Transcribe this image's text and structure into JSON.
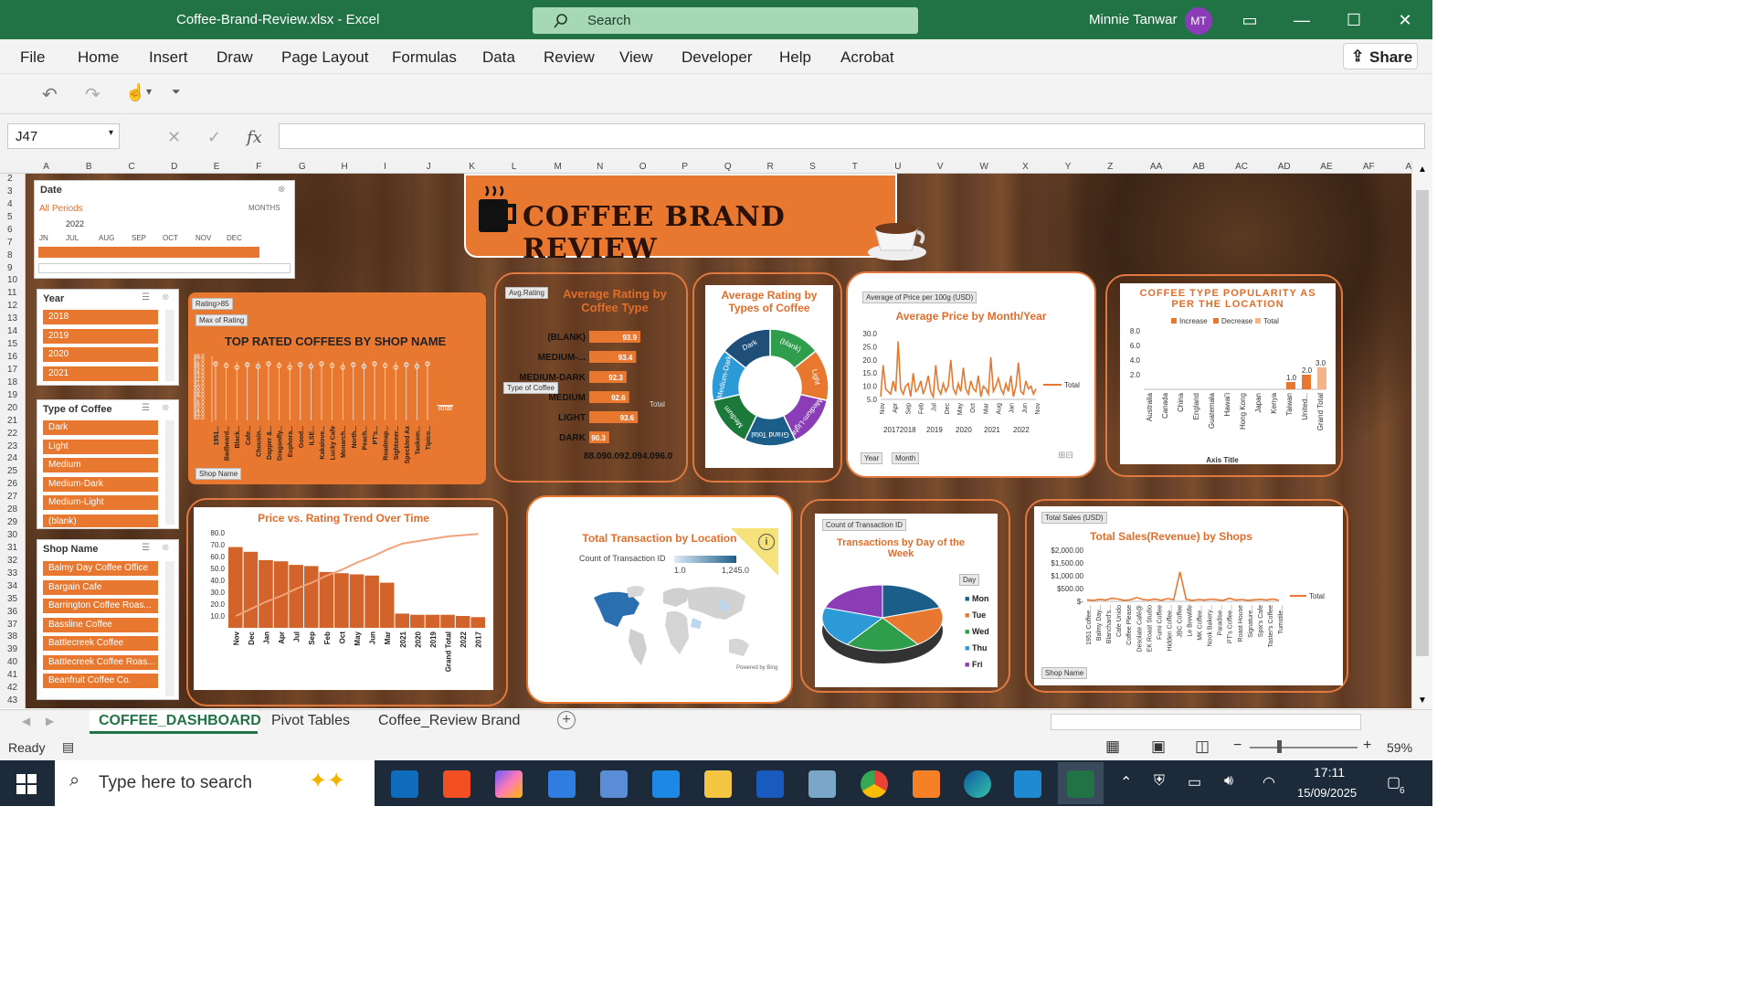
{
  "window": {
    "file_name": "Coffee-Brand-Review.xlsx  -  Excel",
    "search_placeholder": "Search",
    "user_name": "Minnie Tanwar",
    "user_initials": "MT"
  },
  "menu": [
    "File",
    "Home",
    "Insert",
    "Draw",
    "Page Layout",
    "Formulas",
    "Data",
    "Review",
    "View",
    "Developer",
    "Help",
    "Acrobat"
  ],
  "share_label": "Share",
  "formula": {
    "name_box": "J47",
    "fx": "fx",
    "value": ""
  },
  "columns": [
    "A",
    "B",
    "C",
    "D",
    "E",
    "F",
    "G",
    "H",
    "I",
    "J",
    "K",
    "L",
    "M",
    "N",
    "O",
    "P",
    "Q",
    "R",
    "S",
    "T",
    "U",
    "V",
    "W",
    "X",
    "Y",
    "Z",
    "AA",
    "AB",
    "AC",
    "AD",
    "AE",
    "AF",
    "AG"
  ],
  "rows": [
    "2",
    "3",
    "4",
    "5",
    "6",
    "7",
    "8",
    "9",
    "10",
    "11",
    "12",
    "13",
    "14",
    "15",
    "16",
    "17",
    "18",
    "19",
    "20",
    "21",
    "22",
    "23",
    "24",
    "25",
    "26",
    "27",
    "28",
    "29",
    "30",
    "31",
    "32",
    "33",
    "34",
    "35",
    "36",
    "37",
    "38",
    "39",
    "40",
    "41",
    "42",
    "43"
  ],
  "dashboard": {
    "title": "COFFEE BRAND REVIEW",
    "date_slicer": {
      "title": "Date",
      "periods": "All Periods",
      "level": "MONTHS",
      "year": "2022",
      "months": [
        "JN",
        "JUL",
        "AUG",
        "SEP",
        "OCT",
        "NOV",
        "DEC"
      ]
    },
    "year_slicer": {
      "title": "Year",
      "items": [
        "2018",
        "2019",
        "2020",
        "2021"
      ]
    },
    "type_slicer": {
      "title": "Type of Coffee",
      "items": [
        "Dark",
        "Light",
        "Medium",
        "Medium-Dark",
        "Medium-Light",
        "(blank)"
      ]
    },
    "shop_slicer": {
      "title": "Shop Name",
      "items": [
        "Balmy Day Coffee Office",
        "Bargain Cafe",
        "Barrington Coffee Roas...",
        "Bassline Coffee",
        "Battlecreek Coffee",
        "Battlecreek Coffee Roas...",
        "Beanfruit Coffee Co."
      ]
    }
  },
  "charts": {
    "top_rated": {
      "title": "TOP RATED COFFEES BY SHOP NAME",
      "filter": "Rating>85",
      "field": "Max of Rating",
      "legend": "Total",
      "axis_button": "Shop Name",
      "y_ticks": [
        "98.0",
        "97.0",
        "96.0",
        "95.0",
        "94.0",
        "93.0",
        "92.0",
        "91.0",
        "90.0",
        "89.0",
        "88.0",
        "87.0",
        "86.0",
        "85.0",
        "84.0",
        "83.0",
        "82.0"
      ],
      "x_labels": [
        "1951...",
        "Badbeard...",
        "Black...",
        "Cafe...",
        "Chousin...",
        "Dapper &...",
        "Dragonfly...",
        "Euphora...",
        "Good...",
        "ILSE...",
        "Kakalove...",
        "Lucky Cafe",
        "Monarch...",
        "North...",
        "Peach...",
        "PT's...",
        "Roadmap...",
        "Sightseer...",
        "Speckled Ax",
        "Taokem...",
        "Tipico..."
      ]
    },
    "avg_rating": {
      "title": "Average Rating by Coffee Type",
      "field": "Avg.Rating",
      "filter": "Type of Coffee",
      "legend": "Total",
      "categories": [
        "(BLANK)",
        "MEDIUM-...",
        "MEDIUM-DARK",
        "MEDIUM",
        "LIGHT",
        "DARK"
      ],
      "values": [
        93.9,
        93.4,
        92.3,
        92.6,
        93.6,
        90.3
      ],
      "value_labels": [
        "93.9",
        "93.4",
        "92.3",
        "92.6",
        "93.6",
        "90.3"
      ],
      "x_axis": "88.090.092.094.096.0",
      "xlim": [
        88,
        96
      ]
    },
    "types_donut": {
      "title": "Average Rating by Types of Coffee",
      "labels": [
        "(blank)",
        "Light",
        "Medium-Light",
        "Grand Total",
        "Medium",
        "Medium-Dark",
        "Dark"
      ],
      "colors": [
        "#2e9e4c",
        "#e8782f",
        "#8a3db6",
        "#1b5e8a",
        "#1b7a3a",
        "#2b9ad6",
        "#1f4e79"
      ],
      "values": [
        1,
        1,
        1,
        1,
        1,
        1,
        1
      ]
    },
    "avg_price": {
      "title": "Average Price by Month/Year",
      "field": "Average of Price per 100g (USD)",
      "legend": "Total",
      "y_ticks": [
        "30.0",
        "25.0",
        "20.0",
        "15.0",
        "10.0",
        "5.0"
      ],
      "ylim": [
        0,
        30
      ],
      "x_labels": [
        "Nov",
        "Apr",
        "Sep",
        "Feb",
        "Jul",
        "Dec",
        "May",
        "Oct",
        "Mar",
        "Aug",
        "Jan",
        "Jun",
        "Nov"
      ],
      "year_labels": [
        "20172018",
        "2019",
        "2020",
        "2021",
        "2022"
      ],
      "buttons": [
        "Year",
        "Month"
      ],
      "values": [
        6,
        18,
        9,
        8,
        7,
        12,
        8,
        27,
        9,
        7,
        10,
        11,
        6,
        15,
        8,
        9,
        12,
        7,
        10,
        14,
        8,
        6,
        18,
        9,
        7,
        11,
        8,
        10,
        20,
        9,
        7,
        11,
        8,
        17,
        9,
        7,
        12,
        9,
        8,
        14,
        6,
        10,
        9,
        7,
        21,
        8,
        10,
        13,
        9,
        7,
        11,
        8,
        14,
        6,
        10,
        19,
        8,
        7,
        12,
        9,
        10,
        7,
        9
      ]
    },
    "popularity": {
      "title": "COFFEE TYPE POPULARITY AS PER THE  LOCATION",
      "legend": [
        "Increase",
        "Decrease",
        "Total"
      ],
      "y_ticks": [
        "8.0",
        "6.0",
        "4.0",
        "2.0"
      ],
      "x_labels": [
        "Australia",
        "Canada",
        "China",
        "England",
        "Guatemala",
        "Hawai'i",
        "Hong Kong",
        "Japan",
        "Kenya",
        "Taiwan",
        "United...",
        "Grand Total"
      ],
      "value_labels": [
        "1.0",
        "2.0",
        "3.0"
      ],
      "axis_title": "Axis Title",
      "values": [
        0,
        0,
        0,
        0,
        0,
        0,
        0,
        0,
        0,
        1,
        2,
        3
      ]
    },
    "price_rating": {
      "title": "Price vs. Rating Trend Over Time",
      "y_ticks": [
        "80.0",
        "70.0",
        "60.0",
        "50.0",
        "40.0",
        "30.0",
        "20.0",
        "10.0"
      ],
      "ylim": [
        0,
        80
      ],
      "x_labels": [
        "Nov",
        "Dec",
        "Jan",
        "Apr",
        "Jul",
        "Sep",
        "Feb",
        "Oct",
        "May",
        "Jun",
        "Mar",
        "2021",
        "2020",
        "2019",
        "Grand Total",
        "2022",
        "2017"
      ],
      "values": [
        68,
        64,
        57,
        56,
        53,
        52,
        47,
        46,
        45,
        44,
        38,
        12,
        11,
        11,
        11,
        10,
        9
      ],
      "line": [
        10,
        16,
        22,
        27,
        33,
        38,
        44,
        49,
        55,
        60,
        66,
        71,
        73,
        75,
        77,
        78,
        79
      ]
    },
    "transactions_location": {
      "title": "Total Transaction by Location",
      "field": "Count of Transaction ID",
      "scale_min": "1.0",
      "scale_max": "1,245.0",
      "credit": "Powered by Bing",
      "info": "i"
    },
    "transactions_day": {
      "title": "Transactions by Day of the Week",
      "field": "Count of Transaction ID",
      "filter": "Day",
      "days": [
        "Mon",
        "Tue",
        "Wed",
        "Thu",
        "Fri"
      ],
      "colors": [
        "#1b5e8a",
        "#e8782f",
        "#2e9e4c",
        "#2b9ad6",
        "#8a3db6"
      ],
      "values": [
        1,
        1,
        1,
        1,
        1
      ]
    },
    "sales_shops": {
      "title": "Total Sales(Revenue) by Shops",
      "field": "Total Sales (USD)",
      "legend": "Total",
      "axis_button": "Shop Name",
      "y_ticks": [
        "$2,000.00",
        "$1,500.00",
        "$1,000.00",
        "$500.00",
        "$-"
      ],
      "ylim": [
        0,
        2000
      ],
      "x_labels": [
        "1951 Coffee...",
        "Balmy Day...",
        "Blanchard's...",
        "Cafe Unido",
        "Coffee Please",
        "Desolate Café@",
        "EK Roast Studio",
        "Fumi Coffee",
        "Hidden Coffee...",
        "JBC Coffee",
        "Le Brewlife",
        "MK Coffee...",
        "Nook Bakery...",
        "Paradise...",
        "PT's Coffee...",
        "Roast House",
        "Signature...",
        "Spix's Cafe",
        "Taster's Coffee",
        "Tumstile..."
      ],
      "values": [
        60,
        40,
        80,
        50,
        120,
        90,
        40,
        60,
        150,
        70,
        50,
        90,
        40,
        110,
        60,
        1150,
        80,
        40,
        70,
        50,
        90,
        60,
        40,
        120,
        50,
        70,
        40,
        60,
        80,
        50,
        90,
        40
      ]
    }
  },
  "sheets": [
    "COFFEE_DASHBOARD",
    "Pivot Tables",
    "Coffee_Review Brand"
  ],
  "status": {
    "ready": "Ready",
    "zoom": "59%"
  },
  "taskbar": {
    "search_placeholder": "Type here to search",
    "time": "17:11",
    "date": "15/09/2025",
    "notification_count": "6"
  }
}
